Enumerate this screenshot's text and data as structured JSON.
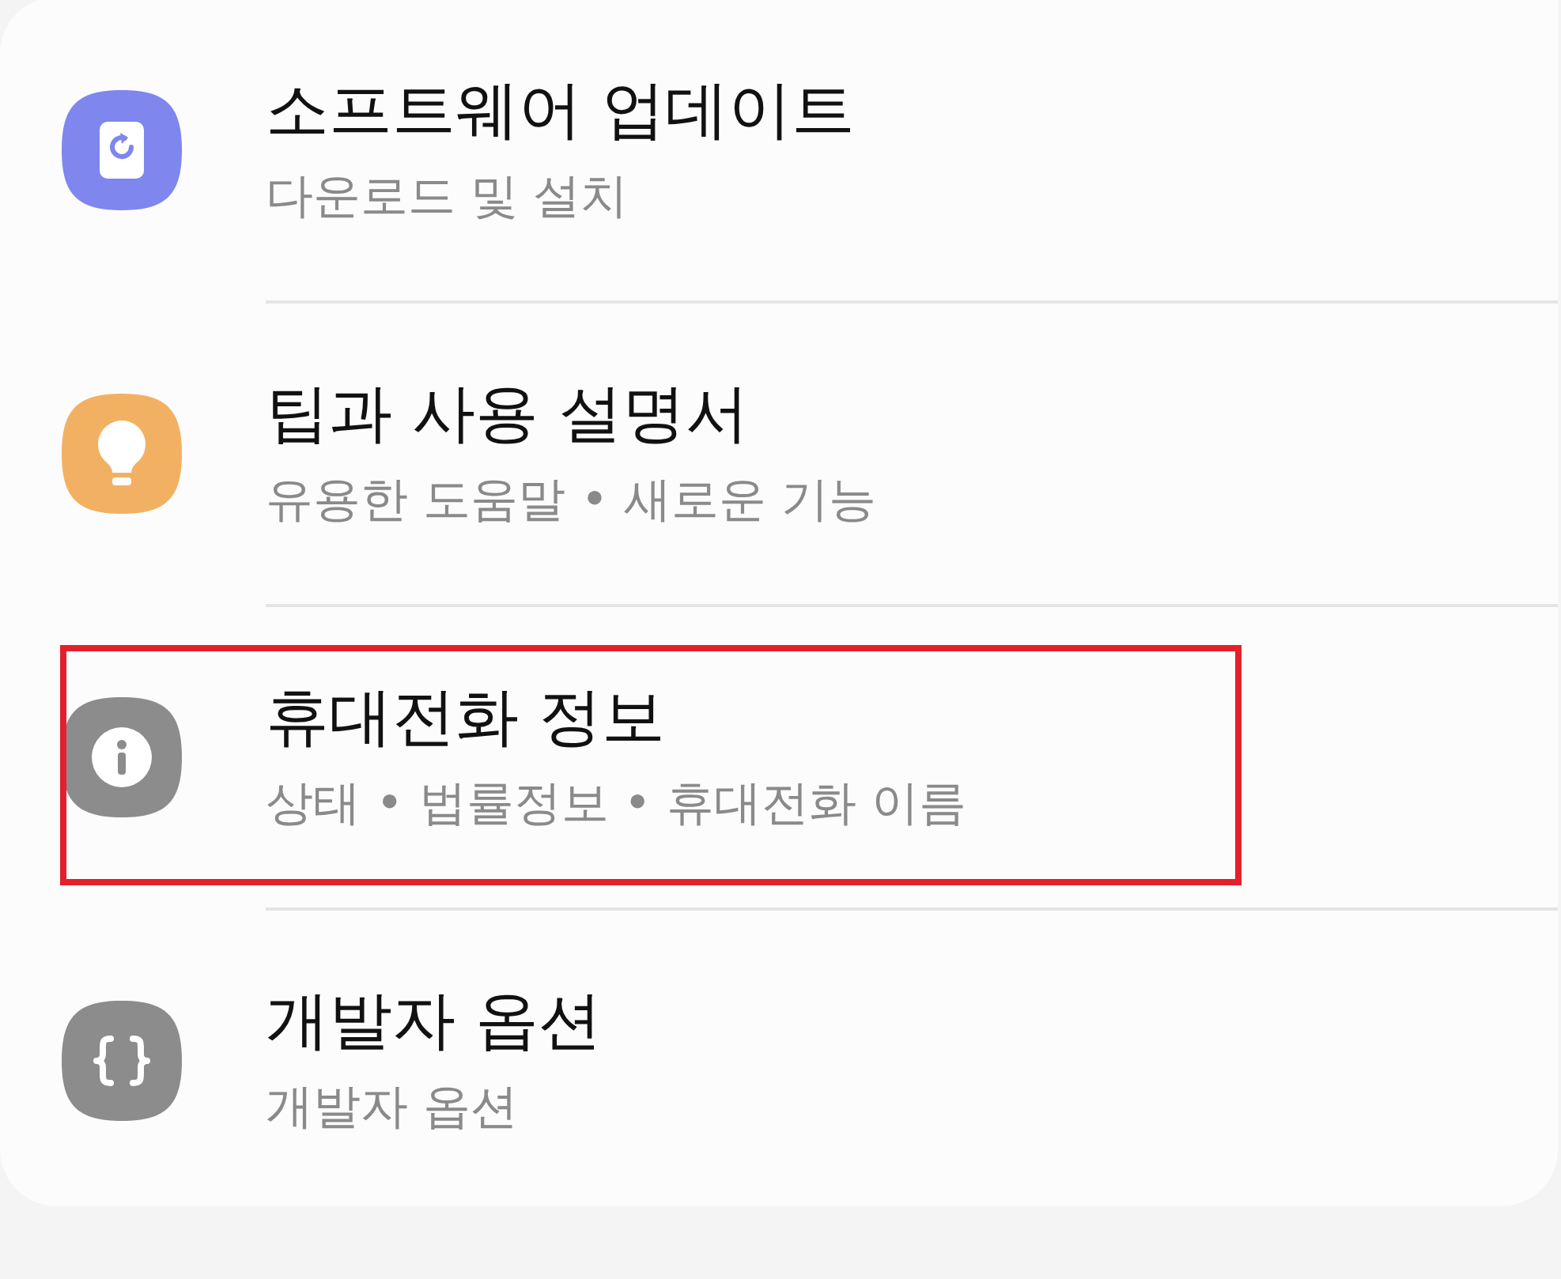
{
  "items": [
    {
      "kind": "update",
      "title": "소프트웨어 업데이트",
      "subtitle": "다운로드 및 설치",
      "highlighted": false
    },
    {
      "kind": "tips",
      "title": "팁과 사용 설명서",
      "subtitle": "유용한 도움말 • 새로운 기능",
      "highlighted": false
    },
    {
      "kind": "info",
      "title": "휴대전화 정보",
      "subtitle": "상태 • 법률정보 • 휴대전화 이름",
      "highlighted": true
    },
    {
      "kind": "developer",
      "title": "개발자 옵션",
      "subtitle": "개발자 옵션",
      "highlighted": false
    }
  ]
}
